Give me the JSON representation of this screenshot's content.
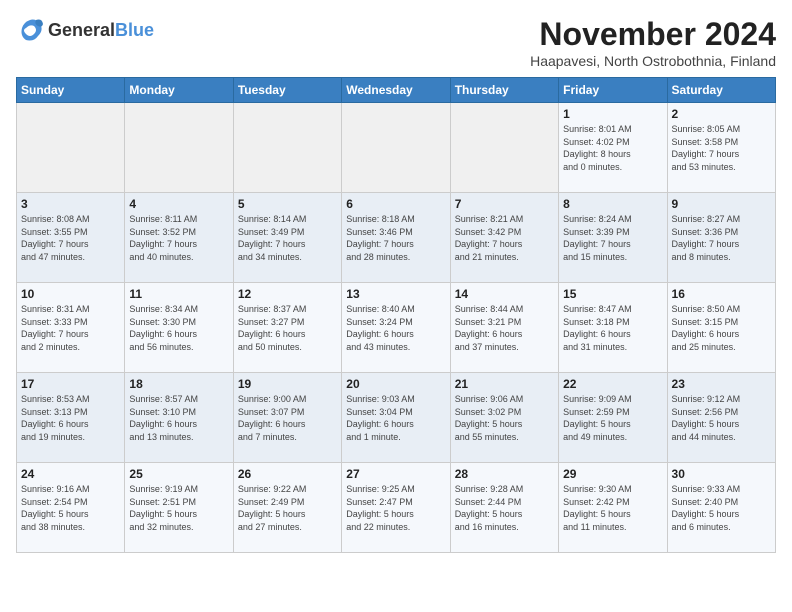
{
  "header": {
    "logo_general": "General",
    "logo_blue": "Blue",
    "month_title": "November 2024",
    "location": "Haapavesi, North Ostrobothnia, Finland"
  },
  "days_of_week": [
    "Sunday",
    "Monday",
    "Tuesday",
    "Wednesday",
    "Thursday",
    "Friday",
    "Saturday"
  ],
  "weeks": [
    [
      {
        "day": "",
        "info": ""
      },
      {
        "day": "",
        "info": ""
      },
      {
        "day": "",
        "info": ""
      },
      {
        "day": "",
        "info": ""
      },
      {
        "day": "",
        "info": ""
      },
      {
        "day": "1",
        "info": "Sunrise: 8:01 AM\nSunset: 4:02 PM\nDaylight: 8 hours\nand 0 minutes."
      },
      {
        "day": "2",
        "info": "Sunrise: 8:05 AM\nSunset: 3:58 PM\nDaylight: 7 hours\nand 53 minutes."
      }
    ],
    [
      {
        "day": "3",
        "info": "Sunrise: 8:08 AM\nSunset: 3:55 PM\nDaylight: 7 hours\nand 47 minutes."
      },
      {
        "day": "4",
        "info": "Sunrise: 8:11 AM\nSunset: 3:52 PM\nDaylight: 7 hours\nand 40 minutes."
      },
      {
        "day": "5",
        "info": "Sunrise: 8:14 AM\nSunset: 3:49 PM\nDaylight: 7 hours\nand 34 minutes."
      },
      {
        "day": "6",
        "info": "Sunrise: 8:18 AM\nSunset: 3:46 PM\nDaylight: 7 hours\nand 28 minutes."
      },
      {
        "day": "7",
        "info": "Sunrise: 8:21 AM\nSunset: 3:42 PM\nDaylight: 7 hours\nand 21 minutes."
      },
      {
        "day": "8",
        "info": "Sunrise: 8:24 AM\nSunset: 3:39 PM\nDaylight: 7 hours\nand 15 minutes."
      },
      {
        "day": "9",
        "info": "Sunrise: 8:27 AM\nSunset: 3:36 PM\nDaylight: 7 hours\nand 8 minutes."
      }
    ],
    [
      {
        "day": "10",
        "info": "Sunrise: 8:31 AM\nSunset: 3:33 PM\nDaylight: 7 hours\nand 2 minutes."
      },
      {
        "day": "11",
        "info": "Sunrise: 8:34 AM\nSunset: 3:30 PM\nDaylight: 6 hours\nand 56 minutes."
      },
      {
        "day": "12",
        "info": "Sunrise: 8:37 AM\nSunset: 3:27 PM\nDaylight: 6 hours\nand 50 minutes."
      },
      {
        "day": "13",
        "info": "Sunrise: 8:40 AM\nSunset: 3:24 PM\nDaylight: 6 hours\nand 43 minutes."
      },
      {
        "day": "14",
        "info": "Sunrise: 8:44 AM\nSunset: 3:21 PM\nDaylight: 6 hours\nand 37 minutes."
      },
      {
        "day": "15",
        "info": "Sunrise: 8:47 AM\nSunset: 3:18 PM\nDaylight: 6 hours\nand 31 minutes."
      },
      {
        "day": "16",
        "info": "Sunrise: 8:50 AM\nSunset: 3:15 PM\nDaylight: 6 hours\nand 25 minutes."
      }
    ],
    [
      {
        "day": "17",
        "info": "Sunrise: 8:53 AM\nSunset: 3:13 PM\nDaylight: 6 hours\nand 19 minutes."
      },
      {
        "day": "18",
        "info": "Sunrise: 8:57 AM\nSunset: 3:10 PM\nDaylight: 6 hours\nand 13 minutes."
      },
      {
        "day": "19",
        "info": "Sunrise: 9:00 AM\nSunset: 3:07 PM\nDaylight: 6 hours\nand 7 minutes."
      },
      {
        "day": "20",
        "info": "Sunrise: 9:03 AM\nSunset: 3:04 PM\nDaylight: 6 hours\nand 1 minute."
      },
      {
        "day": "21",
        "info": "Sunrise: 9:06 AM\nSunset: 3:02 PM\nDaylight: 5 hours\nand 55 minutes."
      },
      {
        "day": "22",
        "info": "Sunrise: 9:09 AM\nSunset: 2:59 PM\nDaylight: 5 hours\nand 49 minutes."
      },
      {
        "day": "23",
        "info": "Sunrise: 9:12 AM\nSunset: 2:56 PM\nDaylight: 5 hours\nand 44 minutes."
      }
    ],
    [
      {
        "day": "24",
        "info": "Sunrise: 9:16 AM\nSunset: 2:54 PM\nDaylight: 5 hours\nand 38 minutes."
      },
      {
        "day": "25",
        "info": "Sunrise: 9:19 AM\nSunset: 2:51 PM\nDaylight: 5 hours\nand 32 minutes."
      },
      {
        "day": "26",
        "info": "Sunrise: 9:22 AM\nSunset: 2:49 PM\nDaylight: 5 hours\nand 27 minutes."
      },
      {
        "day": "27",
        "info": "Sunrise: 9:25 AM\nSunset: 2:47 PM\nDaylight: 5 hours\nand 22 minutes."
      },
      {
        "day": "28",
        "info": "Sunrise: 9:28 AM\nSunset: 2:44 PM\nDaylight: 5 hours\nand 16 minutes."
      },
      {
        "day": "29",
        "info": "Sunrise: 9:30 AM\nSunset: 2:42 PM\nDaylight: 5 hours\nand 11 minutes."
      },
      {
        "day": "30",
        "info": "Sunrise: 9:33 AM\nSunset: 2:40 PM\nDaylight: 5 hours\nand 6 minutes."
      }
    ]
  ]
}
